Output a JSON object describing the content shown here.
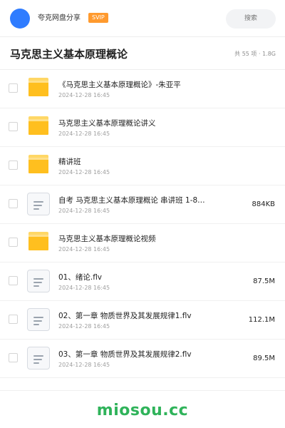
{
  "header": {
    "app_title": "夸克网盘分享",
    "badge": "SVIP",
    "search_placeholder": "搜索"
  },
  "folder": {
    "title": "马克思主义基本原理概论",
    "meta": "共 55 项 · 1.8G"
  },
  "items": [
    {
      "type": "folder",
      "name": "《马克思主义基本原理概论》-朱亚平",
      "date": "2024-12-28 16:45",
      "size": ""
    },
    {
      "type": "folder",
      "name": "马克思主义基本原理概论讲义",
      "date": "2024-12-28 16:45",
      "size": ""
    },
    {
      "type": "folder",
      "name": "精讲班",
      "date": "2024-12-28 16:45",
      "size": ""
    },
    {
      "type": "file",
      "name": "自考 马克思主义基本原理概论 串讲班 1-8…",
      "date": "2024-12-28 16:45",
      "size": "884KB"
    },
    {
      "type": "folder",
      "name": "马克思主义基本原理概论视频",
      "date": "2024-12-28 16:45",
      "size": ""
    },
    {
      "type": "file",
      "name": "01、绪论.flv",
      "date": "2024-12-28 16:45",
      "size": "87.5M"
    },
    {
      "type": "file",
      "name": "02、第一章 物质世界及其发展规律1.flv",
      "date": "2024-12-28 16:45",
      "size": "112.1M"
    },
    {
      "type": "file",
      "name": "03、第一章 物质世界及其发展规律2.flv",
      "date": "2024-12-28 16:45",
      "size": "89.5M"
    }
  ],
  "footer": {
    "watermark": "miosou.cc"
  },
  "colors": {
    "accent_blue": "#2f7cff",
    "svip_orange": "#ff9a2e",
    "folder_yellow": "#ffbf1f",
    "watermark_green": "#2fb35a"
  }
}
